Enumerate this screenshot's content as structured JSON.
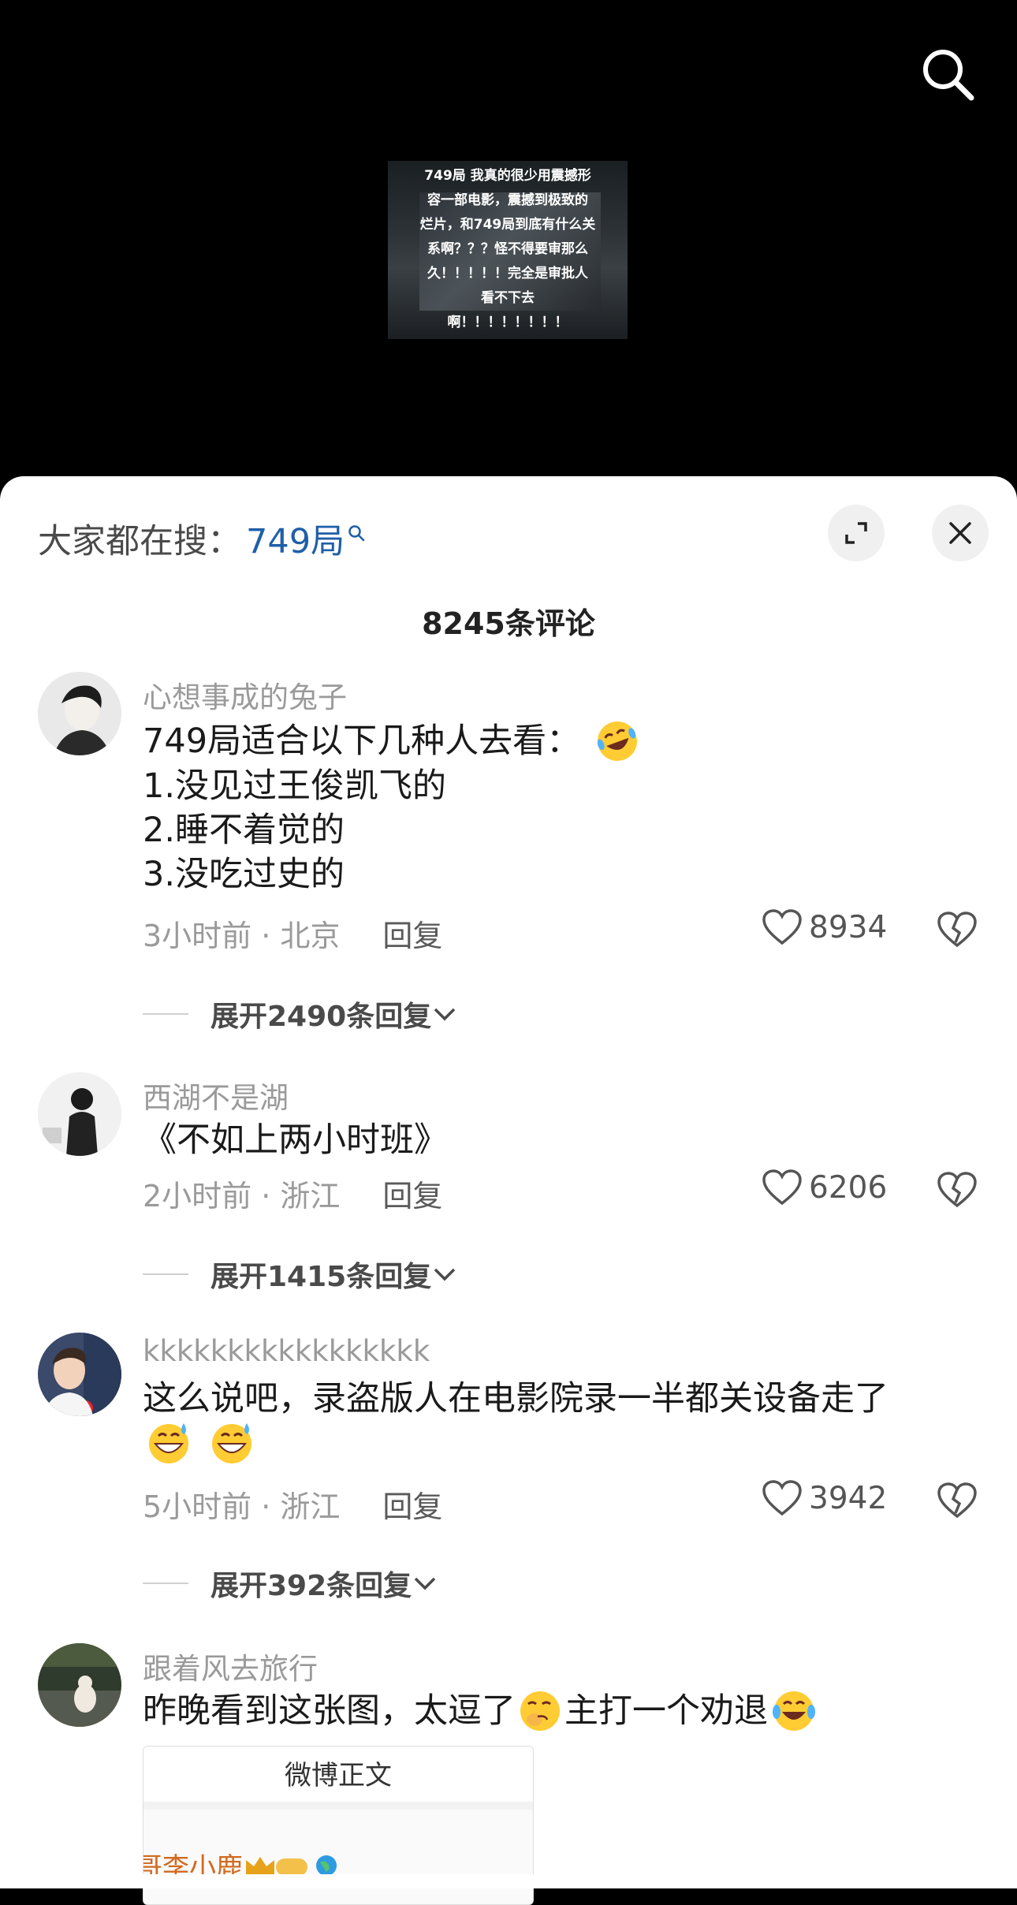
{
  "video": {
    "caption": "749局 我真的很少用震撼形\n容一部电影，震撼到极致的\n烂片，和749局到底有什么关\n系啊？？？怪不得要审那么\n久！！！！！完全是审批人\n看不下去\n啊！！！！！！！！"
  },
  "hot_search": {
    "prefix": "大家都在搜：",
    "keyword": "749局"
  },
  "comment_count": "8245条评论",
  "comments": [
    {
      "username": "心想事成的兔子",
      "lines": [
        "749局适合以下几种人去看：",
        "1.没见过王俊凯飞的",
        "2.睡不着觉的",
        "3.没吃过史的"
      ],
      "meta": "3小时前 · 北京",
      "reply": "回复",
      "likes": "8934",
      "expand": "展开2490条回复"
    },
    {
      "username": "西湖不是湖",
      "lines": [
        "《不如上两小时班》"
      ],
      "meta": "2小时前 · 浙江",
      "reply": "回复",
      "likes": "6206",
      "expand": "展开1415条回复"
    },
    {
      "username": "kkkkkkkkkkkkkkkkk",
      "lines": [
        "这么说吧，录盗版人在电影院录一半都关设备走了"
      ],
      "meta": "5小时前 · 浙江",
      "reply": "回复",
      "likes": "3942",
      "expand": "展开392条回复"
    },
    {
      "username": "跟着风去旅行",
      "text_a": "昨晚看到这张图，太逗了",
      "text_b": "主打一个劝退",
      "embed_title": "微博正文",
      "embed_poster": "哥李小鹿"
    }
  ],
  "icons": {
    "search": "search-icon",
    "expand": "expand-icon",
    "close": "close-icon",
    "like": "heart-icon",
    "dislike": "broken-heart-icon",
    "chevron": "chevron-down-icon"
  }
}
